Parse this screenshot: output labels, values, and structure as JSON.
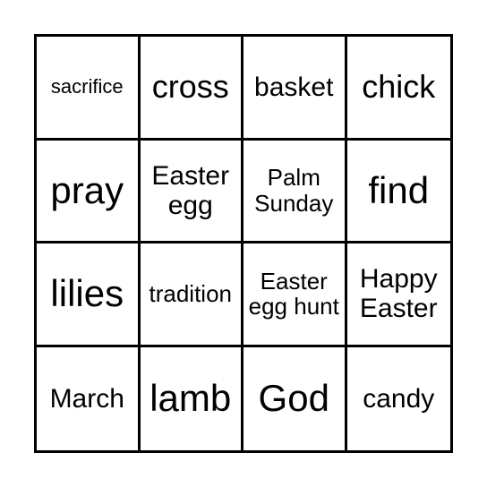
{
  "card": {
    "cells": [
      {
        "text": "sacrifice"
      },
      {
        "text": "cross"
      },
      {
        "text": "basket"
      },
      {
        "text": "chick"
      },
      {
        "text": "pray"
      },
      {
        "text": "Easter egg"
      },
      {
        "text": "Palm Sunday"
      },
      {
        "text": "find"
      },
      {
        "text": "lilies"
      },
      {
        "text": "tradition"
      },
      {
        "text": "Easter egg hunt"
      },
      {
        "text": "Happy Easter"
      },
      {
        "text": "March"
      },
      {
        "text": "lamb"
      },
      {
        "text": "God"
      },
      {
        "text": "candy"
      }
    ]
  }
}
